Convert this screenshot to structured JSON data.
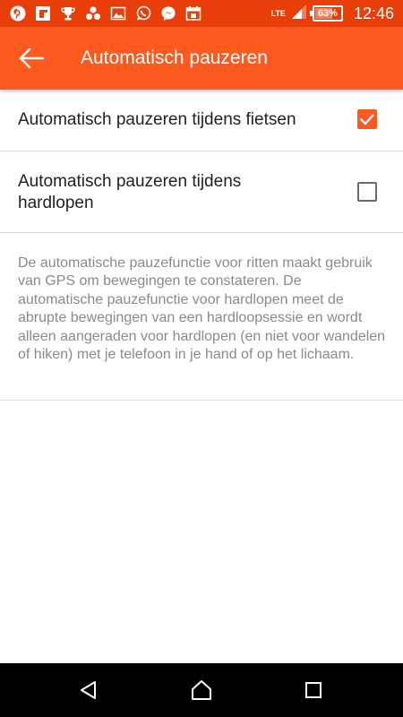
{
  "status_bar": {
    "notification_icons": [
      "pinterest-icon",
      "flipboard-icon",
      "trophy-icon",
      "share-icon",
      "gallery-icon",
      "whatsapp-icon",
      "messenger-icon",
      "calendar-icon"
    ],
    "network": "LTE",
    "battery_percent": "63%",
    "time": "12:46"
  },
  "app_bar": {
    "title": "Automatisch pauzeren",
    "background": "#fc5a1f"
  },
  "settings": [
    {
      "label": "Automatisch pauzeren tijdens fietsen",
      "checked": true
    },
    {
      "label": "Automatisch pauzeren tijdens hardlopen",
      "checked": false
    }
  ],
  "description": "De automatische pauzefunctie voor ritten maakt gebruik van GPS om bewegingen te constateren. De automatische pauzefunctie voor hardlopen meet de abrupte bewegingen van een hardloopsessie en wordt alleen aangeraden voor hardlopen (en niet voor wandelen of hiken) met je telefoon in je hand of op het lichaam.",
  "colors": {
    "accent": "#fc5a1f",
    "status_bar": "#e83f0a",
    "body_text": "#212121",
    "secondary_text": "#8a8a8a"
  }
}
